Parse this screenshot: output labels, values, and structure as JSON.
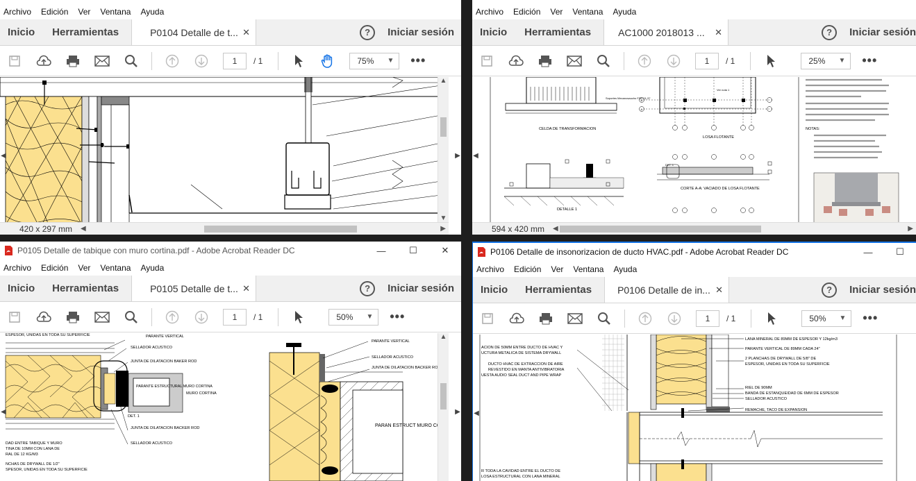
{
  "menu": [
    "Archivo",
    "Edición",
    "Ver",
    "Ventana",
    "Ayuda"
  ],
  "nav": {
    "home": "Inicio",
    "tools": "Herramientas",
    "signin": "Iniciar sesión",
    "help": "?"
  },
  "windows": [
    {
      "tab": "P0104 Detalle de t...",
      "page": "1",
      "pages": "/ 1",
      "zoom": "75%",
      "size": "420 x 297 mm"
    },
    {
      "tab": "AC1000 2018013 ...",
      "page": "1",
      "pages": "/ 1",
      "zoom": "25%",
      "size": "594 x 420 mm",
      "labels": {
        "celda": "CELDA DE TRANSFORMACION",
        "losa": "LOSA FLOTANTE",
        "detalle": "DETALLE 1",
        "corte": "CORTE A-A: VACIADO DE LOSA FLOTANTE",
        "notas": "NOTAS:",
        "note1": "1. La distancia máxima entre soportes antivibratorios FZH",
        "note2": "2. Colocar el transformador en la losa flotante sobre los",
        "det": "DET. 1",
        "soportes": "Soportes Mecanosaucho FZH 01-37",
        "row_a": "A",
        "row_b": "B",
        "dim": "Ver nota 1"
      }
    },
    {
      "title": "P0105 Detalle de tabique con muro cortina.pdf - Adobe Acrobat Reader DC",
      "tab": "P0105 Detalle de t...",
      "page": "1",
      "pages": "/ 1",
      "zoom": "50%",
      "labels": {
        "a1": "ESPESOR, UNIDAS EN TODA SU SUPERFICIE",
        "a2": "PARANTE VERTICAL",
        "a3": "SELLADOR ACUSTICO",
        "a4": "JUNTA DE DILATACION BAKER ROD",
        "parante": "PARANTE ESTRUCTURAL MURO CORTINA",
        "muro": "MURO CORTINA",
        "det": "DET. 1",
        "a5": "JUNTA DE DILATACION BACKER ROD",
        "a6": "SELLADOR ACUSTICO",
        "a7": "DAD ENTRE TABIQUE Y MURO",
        "a8": "TINA DE 10MM CON LANA DE",
        "a9": "RAL DE 12 KG/M3",
        "a10": "NCHAS DE DRYWALL DE 1/2\"",
        "a11": "SPESOR, UNIDAS EN TODA SU SUPERFICIE",
        "b1": "PARANTE VERTICAL",
        "b2": "SELLADOR ACUSTICO",
        "b3": "JUNTA DE DILATACION BACKER ROD",
        "b4": "PARAN ESTRUCT MURO CO"
      }
    },
    {
      "title": "P0106 Detalle de insonorizacion de ducto HVAC.pdf - Adobe Acrobat Reader DC",
      "tab": "P0106 Detalle de in...",
      "page": "1",
      "pages": "/ 1",
      "zoom": "50%",
      "labels": {
        "c1": "ACION DE 50MM ENTRE DUCTO DE HVAC Y",
        "c2": "UCTURA METALICA DE SISTEMA DRYWALL",
        "c3": "DUCTO HVAC DE EXTRACCION DE AIRE",
        "c4": "REVESTIDO EN MANTA ANTIVIBRATORIA",
        "c5": "UESTA AUDIO SEAL DUCT AND PIPE WRAP",
        "r1": "LANA MINERAL DE 89MM DE ESPESOR Y 12kg/m3",
        "r2": "PARANTE VERTICAL DE 89MM CADA 24\"",
        "r3": "2 PLANCHAS DE DRYWALL DE 5/8\" DE",
        "r4": "ESPESOR, UNIDAS EN TODA SU SUPERFICIE",
        "r5": "RIEL DE 90MM",
        "r6": "BANDA DE ESTANQUEIDAD DE 6MM DE ESPESOR",
        "r7": "SELLADOR ACUSTICO",
        "r8": "REMACHE, TACO DE EXPANSION",
        "c6": "R TODA LA CAVIDAD ENTRE EL DUCTO DE",
        "c7": "LOSA ESTRUCTURAL CON LANA MINERAL"
      }
    }
  ],
  "colors": {
    "insulation": "#fbe08f",
    "steel": "#888888",
    "accent": "#1473e6"
  }
}
